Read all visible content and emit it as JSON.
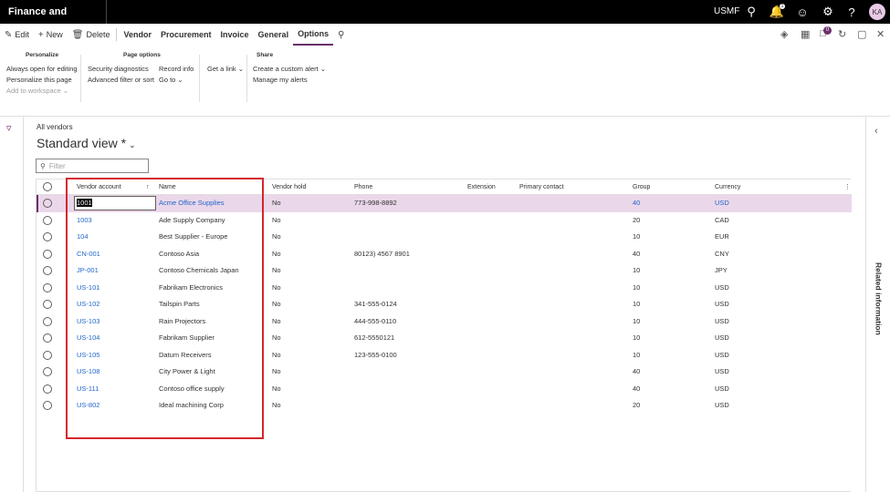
{
  "topbar": {
    "app_title": "Finance and Operations",
    "company": "USMF",
    "avatar_initials": "KA",
    "notification_count": "1"
  },
  "actionbar": {
    "edit": "Edit",
    "new": "New",
    "delete": "Delete",
    "tabs": [
      "Vendor",
      "Procurement",
      "Invoice",
      "General",
      "Options"
    ],
    "selected_tab": "Options",
    "badge_count": "0"
  },
  "ribbon": {
    "personalize": {
      "title": "Personalize",
      "items": [
        "Always open for editing",
        "Personalize this page",
        "Add to workspace"
      ]
    },
    "page_options": {
      "title": "Page options",
      "items": [
        "Security diagnostics",
        "Advanced filter or sort",
        "Record info",
        "Go to"
      ]
    },
    "get_link": "Get a link",
    "share": {
      "title": "Share",
      "items": [
        "Create a custom alert",
        "Manage my alerts"
      ]
    }
  },
  "page": {
    "breadcrumb": "All vendors",
    "view_title": "Standard view *",
    "filter_placeholder": "Filter",
    "right_panel_label": "Related information"
  },
  "grid": {
    "columns": [
      "Vendor account",
      "Name",
      "Vendor hold",
      "Phone",
      "Extension",
      "Primary contact",
      "Group",
      "Currency"
    ],
    "rows": [
      {
        "account": "1001",
        "name": "Acme Office Supplies",
        "hold": "No",
        "phone": "773-998-8892",
        "group": "40",
        "currency": "USD"
      },
      {
        "account": "1003",
        "name": "Ade Supply Company",
        "hold": "No",
        "phone": "",
        "group": "20",
        "currency": "CAD"
      },
      {
        "account": "104",
        "name": "Best Supplier - Europe",
        "hold": "No",
        "phone": "",
        "group": "10",
        "currency": "EUR"
      },
      {
        "account": "CN-001",
        "name": "Contoso Asia",
        "hold": "No",
        "phone": "80123) 4567 8901",
        "group": "40",
        "currency": "CNY"
      },
      {
        "account": "JP-001",
        "name": "Contoso Chemicals Japan",
        "hold": "No",
        "phone": "",
        "group": "10",
        "currency": "JPY"
      },
      {
        "account": "US-101",
        "name": "Fabrikam Electronics",
        "hold": "No",
        "phone": "",
        "group": "10",
        "currency": "USD"
      },
      {
        "account": "US-102",
        "name": "Tailspin Parts",
        "hold": "No",
        "phone": "341-555-0124",
        "group": "10",
        "currency": "USD"
      },
      {
        "account": "US-103",
        "name": "Rain Projectors",
        "hold": "No",
        "phone": "444-555-0110",
        "group": "10",
        "currency": "USD"
      },
      {
        "account": "US-104",
        "name": "Fabrikam Supplier",
        "hold": "No",
        "phone": "612-5550121",
        "group": "10",
        "currency": "USD"
      },
      {
        "account": "US-105",
        "name": "Datum Receivers",
        "hold": "No",
        "phone": "123-555-0100",
        "group": "10",
        "currency": "USD"
      },
      {
        "account": "US-108",
        "name": "City Power & Light",
        "hold": "No",
        "phone": "",
        "group": "40",
        "currency": "USD"
      },
      {
        "account": "US-111",
        "name": "Contoso office supply",
        "hold": "No",
        "phone": "",
        "group": "40",
        "currency": "USD"
      },
      {
        "account": "US-802",
        "name": "Ideal machining Corp",
        "hold": "No",
        "phone": "",
        "group": "20",
        "currency": "USD"
      }
    ]
  },
  "colors": {
    "accent": "#6b2f6b",
    "link": "#2266c9",
    "selected_row": "#ead7ea",
    "highlight": "#d6262e"
  }
}
